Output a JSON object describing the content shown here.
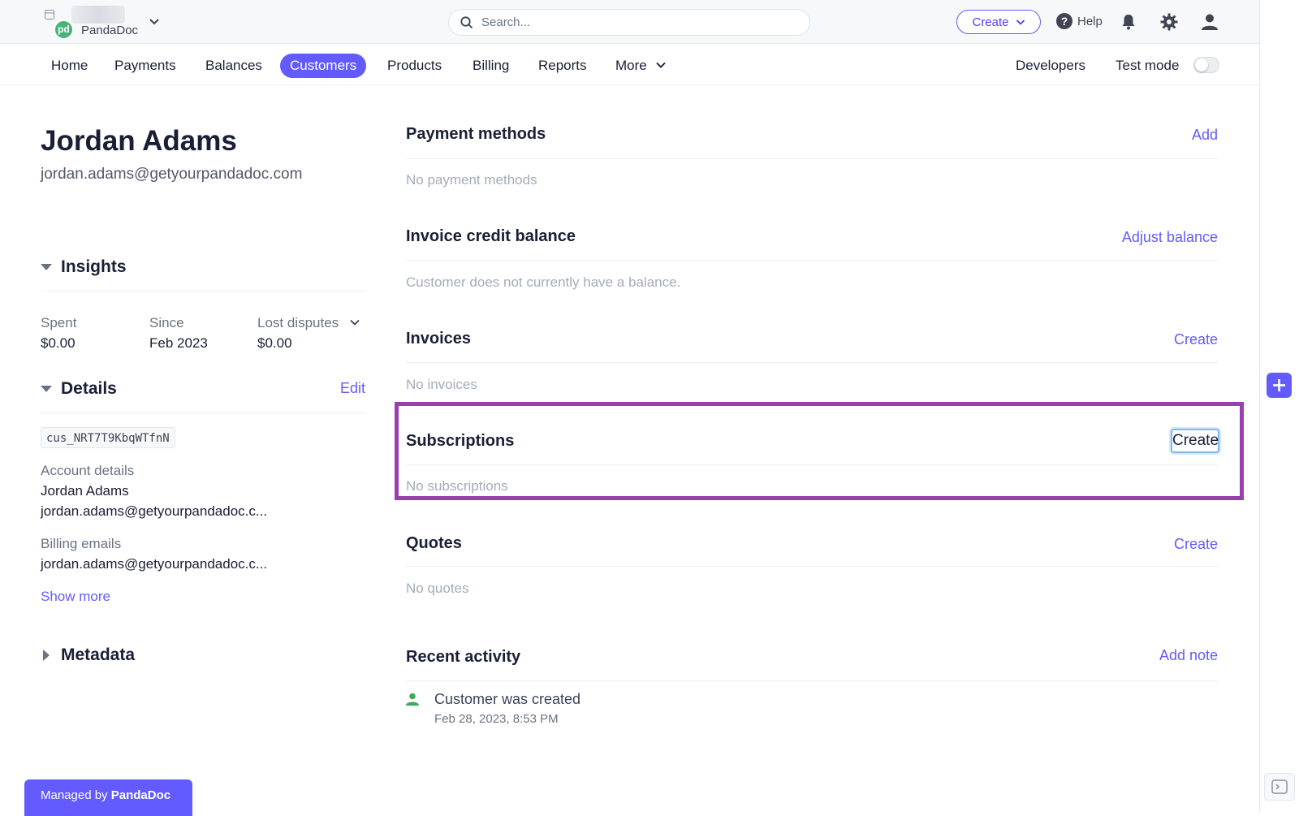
{
  "header": {
    "org_name": "PandaDoc",
    "search_placeholder": "Search...",
    "create_label": "Create",
    "help_label": "Help"
  },
  "nav": {
    "items": [
      "Home",
      "Payments",
      "Balances",
      "Customers",
      "Products",
      "Billing",
      "Reports",
      "More"
    ],
    "active": "Customers",
    "developers": "Developers",
    "test_mode": "Test mode"
  },
  "customer": {
    "name": "Jordan Adams",
    "email": "jordan.adams@getyourpandadoc.com"
  },
  "insights": {
    "title": "Insights",
    "spent_label": "Spent",
    "spent_value": "$0.00",
    "since_label": "Since",
    "since_value": "Feb 2023",
    "disputes_label": "Lost disputes",
    "disputes_value": "$0.00"
  },
  "details": {
    "title": "Details",
    "edit": "Edit",
    "customer_id": "cus_NRT7T9KbqWTfnN",
    "account_label": "Account details",
    "account_name": "Jordan Adams",
    "account_email": "jordan.adams@getyourpandadoc.c...",
    "billing_label": "Billing emails",
    "billing_email": "jordan.adams@getyourpandadoc.c...",
    "show_more": "Show more"
  },
  "metadata": {
    "title": "Metadata"
  },
  "managed": {
    "prefix": "Managed by",
    "brand": "PandaDoc"
  },
  "cards": {
    "payment_methods": {
      "title": "Payment methods",
      "action": "Add",
      "empty": "No payment methods"
    },
    "credit_balance": {
      "title": "Invoice credit balance",
      "action": "Adjust balance",
      "empty": "Customer does not currently have a balance."
    },
    "invoices": {
      "title": "Invoices",
      "action": "Create",
      "empty": "No invoices"
    },
    "subscriptions": {
      "title": "Subscriptions",
      "action": "Create",
      "empty": "No subscriptions"
    },
    "quotes": {
      "title": "Quotes",
      "action": "Create",
      "empty": "No quotes"
    },
    "activity": {
      "title": "Recent activity",
      "action": "Add note",
      "event": "Customer was created",
      "date": "Feb 28, 2023, 8:53 PM"
    }
  },
  "colors": {
    "accent": "#635bff",
    "highlight": "#9a3fae",
    "success": "#3da85a"
  }
}
